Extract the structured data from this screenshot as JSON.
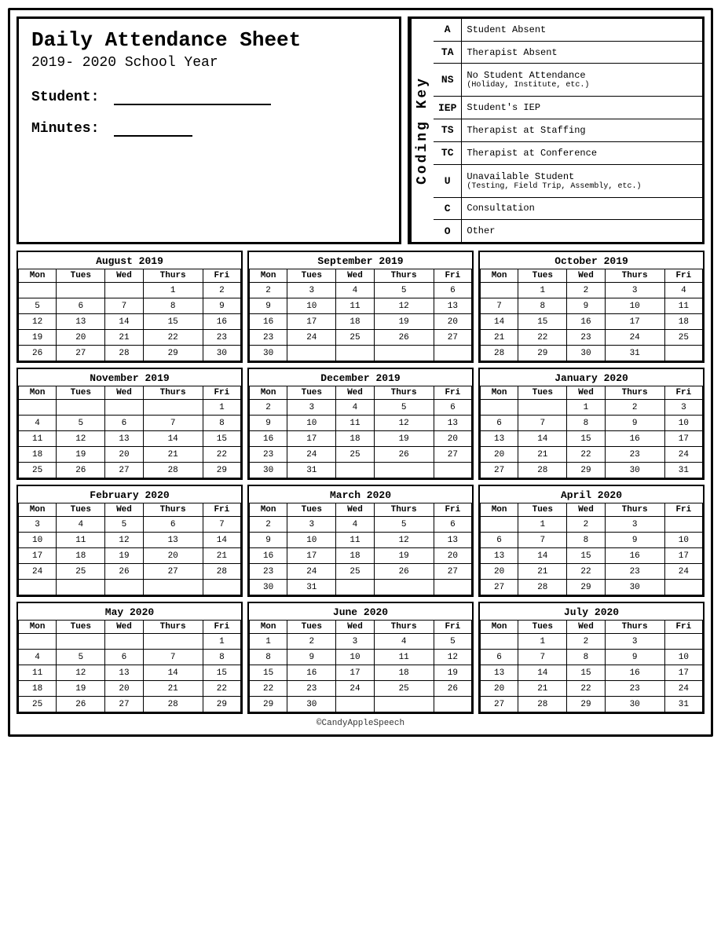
{
  "header": {
    "title": "Daily Attendance Sheet",
    "year": "2019- 2020 School Year",
    "student_label": "Student:",
    "minutes_label": "Minutes:"
  },
  "coding_key": {
    "label": "Coding Key",
    "items": [
      {
        "code": "A",
        "description": "Student Absent",
        "sub": ""
      },
      {
        "code": "TA",
        "description": "Therapist Absent",
        "sub": ""
      },
      {
        "code": "NS",
        "description": "No Student Attendance",
        "sub": "(Holiday, Institute, etc.)"
      },
      {
        "code": "IEP",
        "description": "Student's IEP",
        "sub": ""
      },
      {
        "code": "TS",
        "description": "Therapist at Staffing",
        "sub": ""
      },
      {
        "code": "TC",
        "description": "Therapist at Conference",
        "sub": ""
      },
      {
        "code": "U",
        "description": "Unavailable Student",
        "sub": "(Testing, Field Trip, Assembly, etc.)"
      },
      {
        "code": "C",
        "description": "Consultation",
        "sub": ""
      },
      {
        "code": "O",
        "description": "Other",
        "sub": ""
      }
    ]
  },
  "calendars": [
    {
      "title": "August 2019",
      "headers": [
        "Mon",
        "Tues",
        "Wed",
        "Thurs",
        "Fri"
      ],
      "rows": [
        [
          "",
          "",
          "",
          "1",
          "2"
        ],
        [
          "5",
          "6",
          "7",
          "8",
          "9"
        ],
        [
          "12",
          "13",
          "14",
          "15",
          "16"
        ],
        [
          "19",
          "20",
          "21",
          "22",
          "23"
        ],
        [
          "26",
          "27",
          "28",
          "29",
          "30"
        ]
      ]
    },
    {
      "title": "September 2019",
      "headers": [
        "Mon",
        "Tues",
        "Wed",
        "Thurs",
        "Fri"
      ],
      "rows": [
        [
          "2",
          "3",
          "4",
          "5",
          "6"
        ],
        [
          "9",
          "10",
          "11",
          "12",
          "13"
        ],
        [
          "16",
          "17",
          "18",
          "19",
          "20"
        ],
        [
          "23",
          "24",
          "25",
          "26",
          "27"
        ],
        [
          "30",
          "",
          "",
          "",
          ""
        ]
      ]
    },
    {
      "title": "October 2019",
      "headers": [
        "Mon",
        "Tues",
        "Wed",
        "Thurs",
        "Fri"
      ],
      "rows": [
        [
          "",
          "1",
          "2",
          "3",
          "4"
        ],
        [
          "7",
          "8",
          "9",
          "10",
          "11"
        ],
        [
          "14",
          "15",
          "16",
          "17",
          "18"
        ],
        [
          "21",
          "22",
          "23",
          "24",
          "25"
        ],
        [
          "28",
          "29",
          "30",
          "31",
          ""
        ]
      ]
    },
    {
      "title": "November 2019",
      "headers": [
        "Mon",
        "Tues",
        "Wed",
        "Thurs",
        "Fri"
      ],
      "rows": [
        [
          "",
          "",
          "",
          "",
          "1"
        ],
        [
          "4",
          "5",
          "6",
          "7",
          "8"
        ],
        [
          "11",
          "12",
          "13",
          "14",
          "15"
        ],
        [
          "18",
          "19",
          "20",
          "21",
          "22"
        ],
        [
          "25",
          "26",
          "27",
          "28",
          "29"
        ]
      ]
    },
    {
      "title": "December 2019",
      "headers": [
        "Mon",
        "Tues",
        "Wed",
        "Thurs",
        "Fri"
      ],
      "rows": [
        [
          "2",
          "3",
          "4",
          "5",
          "6"
        ],
        [
          "9",
          "10",
          "11",
          "12",
          "13"
        ],
        [
          "16",
          "17",
          "18",
          "19",
          "20"
        ],
        [
          "23",
          "24",
          "25",
          "26",
          "27"
        ],
        [
          "30",
          "31",
          "",
          "",
          ""
        ]
      ]
    },
    {
      "title": "January 2020",
      "headers": [
        "Mon",
        "Tues",
        "Wed",
        "Thurs",
        "Fri"
      ],
      "rows": [
        [
          "",
          "",
          "1",
          "2",
          "3"
        ],
        [
          "6",
          "7",
          "8",
          "9",
          "10"
        ],
        [
          "13",
          "14",
          "15",
          "16",
          "17"
        ],
        [
          "20",
          "21",
          "22",
          "23",
          "24"
        ],
        [
          "27",
          "28",
          "29",
          "30",
          "31"
        ]
      ]
    },
    {
      "title": "February 2020",
      "headers": [
        "Mon",
        "Tues",
        "Wed",
        "Thurs",
        "Fri"
      ],
      "rows": [
        [
          "3",
          "4",
          "5",
          "6",
          "7"
        ],
        [
          "10",
          "11",
          "12",
          "13",
          "14"
        ],
        [
          "17",
          "18",
          "19",
          "20",
          "21"
        ],
        [
          "24",
          "25",
          "26",
          "27",
          "28"
        ],
        [
          "",
          "",
          "",
          "",
          ""
        ]
      ]
    },
    {
      "title": "March 2020",
      "headers": [
        "Mon",
        "Tues",
        "Wed",
        "Thurs",
        "Fri"
      ],
      "rows": [
        [
          "2",
          "3",
          "4",
          "5",
          "6"
        ],
        [
          "9",
          "10",
          "11",
          "12",
          "13"
        ],
        [
          "16",
          "17",
          "18",
          "19",
          "20"
        ],
        [
          "23",
          "24",
          "25",
          "26",
          "27"
        ],
        [
          "30",
          "31",
          "",
          "",
          ""
        ]
      ]
    },
    {
      "title": "April 2020",
      "headers": [
        "Mon",
        "Tues",
        "Wed",
        "Thurs",
        "Fri"
      ],
      "rows": [
        [
          "",
          "1",
          "2",
          "3",
          ""
        ],
        [
          "6",
          "7",
          "8",
          "9",
          "10"
        ],
        [
          "13",
          "14",
          "15",
          "16",
          "17"
        ],
        [
          "20",
          "21",
          "22",
          "23",
          "24"
        ],
        [
          "27",
          "28",
          "29",
          "30",
          ""
        ]
      ]
    },
    {
      "title": "May 2020",
      "headers": [
        "Mon",
        "Tues",
        "Wed",
        "Thurs",
        "Fri"
      ],
      "rows": [
        [
          "",
          "",
          "",
          "",
          "1"
        ],
        [
          "4",
          "5",
          "6",
          "7",
          "8"
        ],
        [
          "11",
          "12",
          "13",
          "14",
          "15"
        ],
        [
          "18",
          "19",
          "20",
          "21",
          "22"
        ],
        [
          "25",
          "26",
          "27",
          "28",
          "29"
        ]
      ]
    },
    {
      "title": "June 2020",
      "headers": [
        "Mon",
        "Tues",
        "Wed",
        "Thurs",
        "Fri"
      ],
      "rows": [
        [
          "1",
          "2",
          "3",
          "4",
          "5"
        ],
        [
          "8",
          "9",
          "10",
          "11",
          "12"
        ],
        [
          "15",
          "16",
          "17",
          "18",
          "19"
        ],
        [
          "22",
          "23",
          "24",
          "25",
          "26"
        ],
        [
          "29",
          "30",
          "",
          "",
          ""
        ]
      ]
    },
    {
      "title": "July 2020",
      "headers": [
        "Mon",
        "Tues",
        "Wed",
        "Thurs",
        "Fri"
      ],
      "rows": [
        [
          "",
          "1",
          "2",
          "3",
          ""
        ],
        [
          "6",
          "7",
          "8",
          "9",
          "10"
        ],
        [
          "13",
          "14",
          "15",
          "16",
          "17"
        ],
        [
          "20",
          "21",
          "22",
          "23",
          "24"
        ],
        [
          "27",
          "28",
          "29",
          "30",
          "31"
        ]
      ]
    }
  ],
  "footer": "©CandyAppleSpeech"
}
